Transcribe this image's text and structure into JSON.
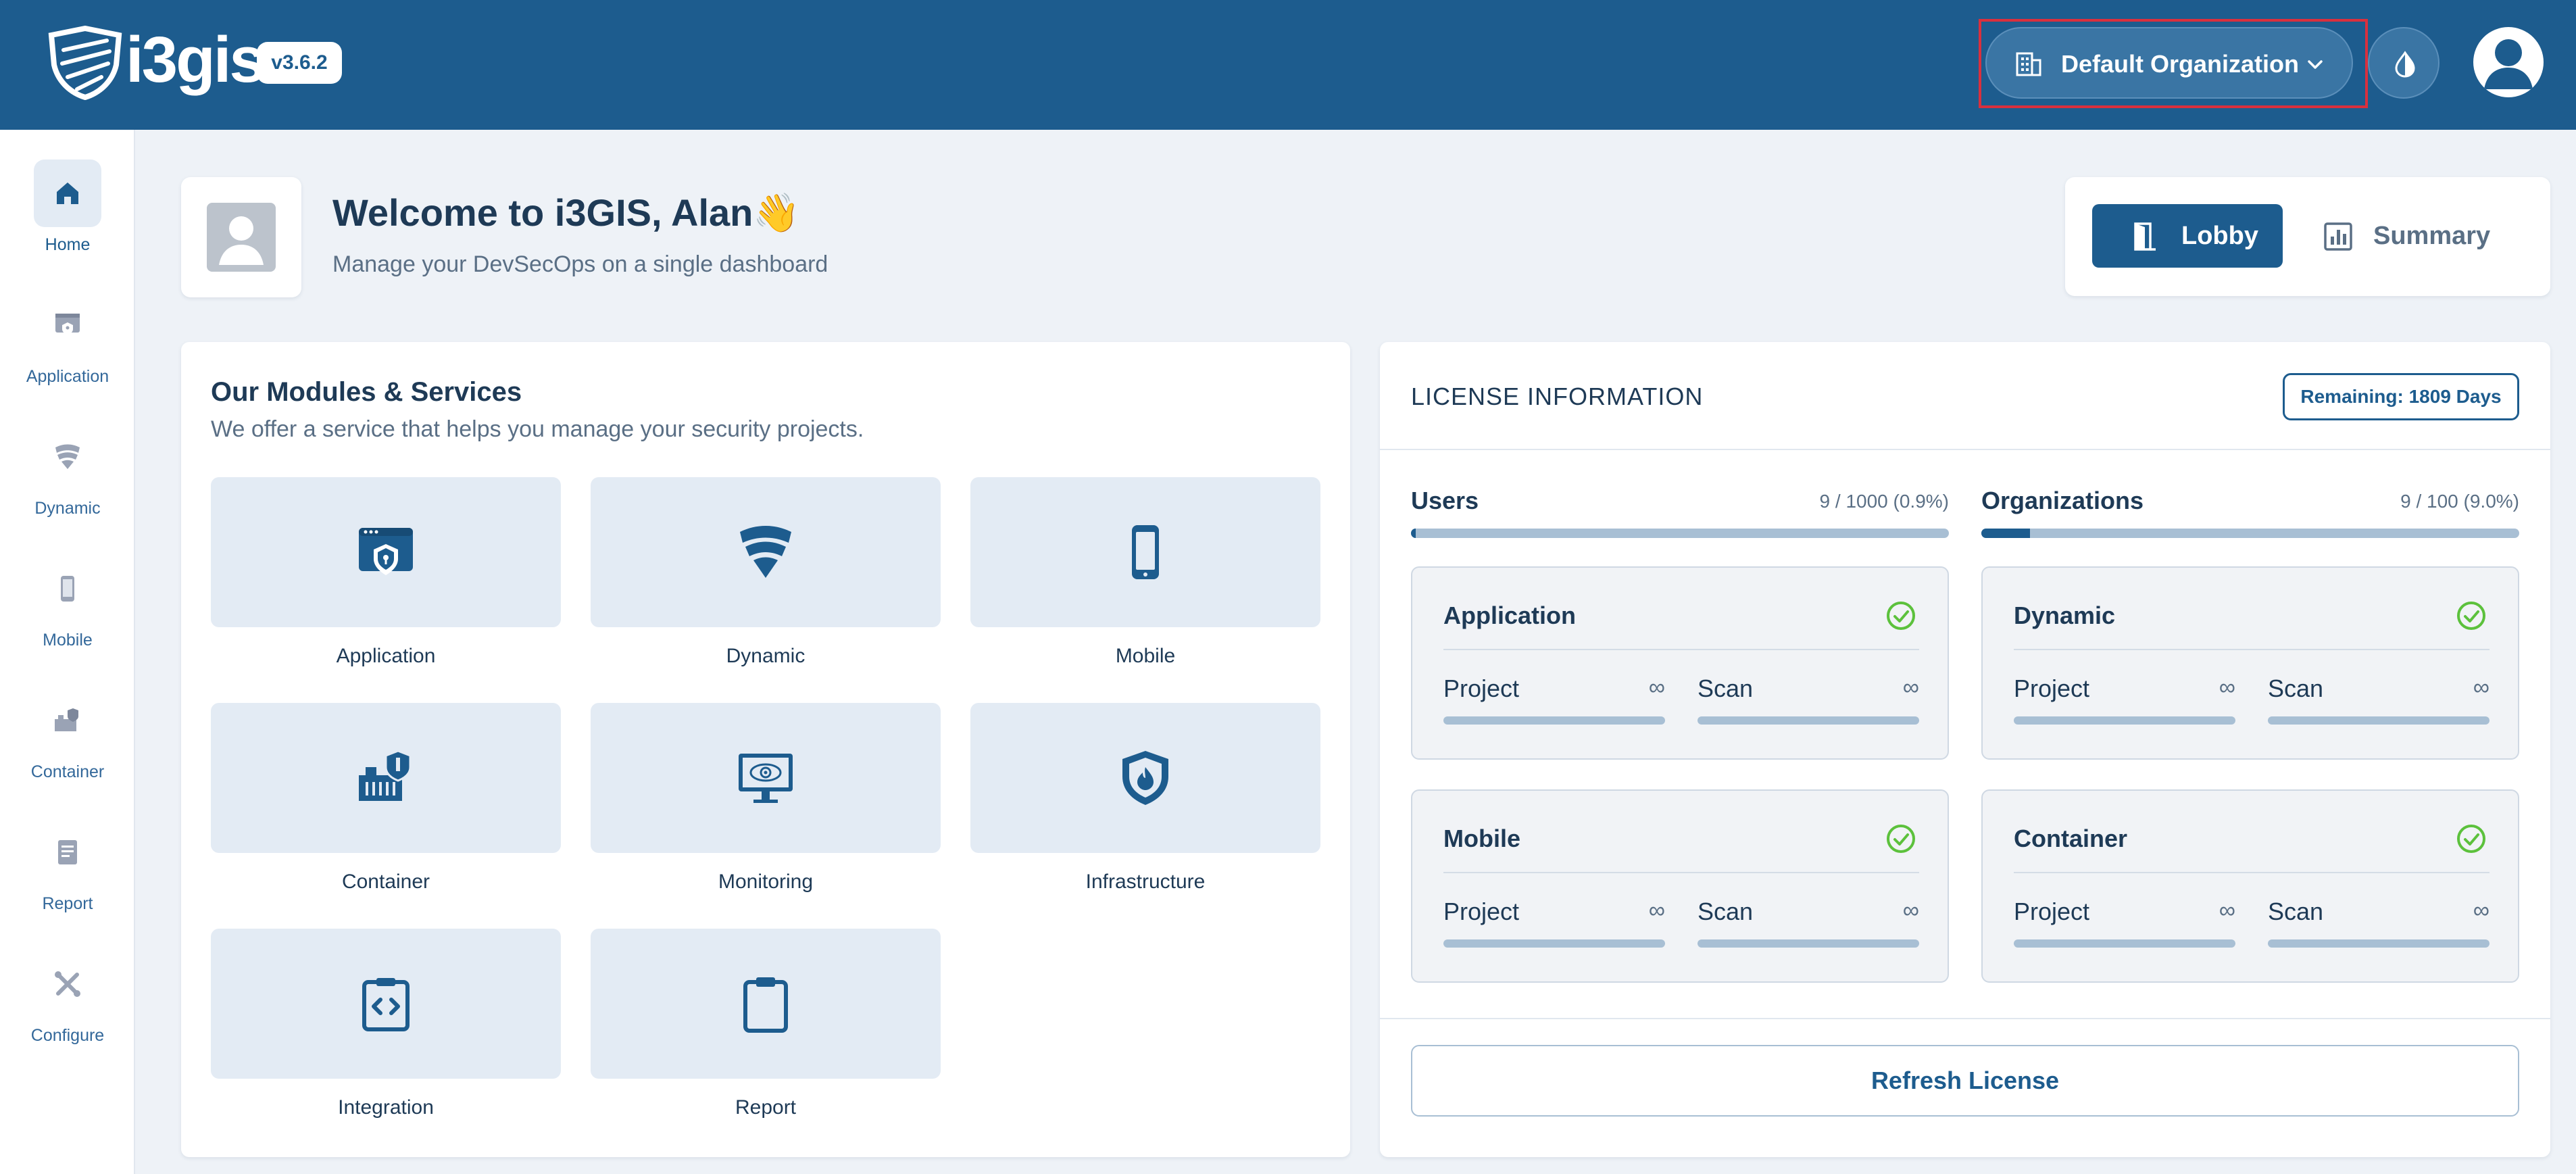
{
  "app": {
    "brand": "i3gis",
    "version": "v3.6.2"
  },
  "header": {
    "organization": "Default Organization",
    "icons": [
      "organization-icon",
      "chevron-down-icon",
      "theme-icon",
      "user-avatar-icon"
    ]
  },
  "sidebar": {
    "items": [
      {
        "label": "Home",
        "icon": "home-icon",
        "active": true
      },
      {
        "label": "Application",
        "icon": "application-icon"
      },
      {
        "label": "Dynamic",
        "icon": "dynamic-icon"
      },
      {
        "label": "Mobile",
        "icon": "mobile-icon"
      },
      {
        "label": "Container",
        "icon": "container-icon"
      },
      {
        "label": "Report",
        "icon": "report-icon"
      },
      {
        "label": "Configure",
        "icon": "configure-icon"
      }
    ]
  },
  "welcome": {
    "title": "Welcome to i3GIS, Alan",
    "emoji": "👋",
    "subtitle": "Manage your DevSecOps on a single dashboard"
  },
  "view_switch": {
    "lobby": "Lobby",
    "summary": "Summary",
    "active": "lobby"
  },
  "modules": {
    "title": "Our Modules & Services",
    "subtitle": "We offer a service that helps you manage your security projects.",
    "items": [
      {
        "label": "Application",
        "icon": "application-icon"
      },
      {
        "label": "Dynamic",
        "icon": "dynamic-icon"
      },
      {
        "label": "Mobile",
        "icon": "mobile-icon"
      },
      {
        "label": "Container",
        "icon": "container-icon"
      },
      {
        "label": "Monitoring",
        "icon": "monitoring-icon"
      },
      {
        "label": "Infrastructure",
        "icon": "infrastructure-icon"
      },
      {
        "label": "Integration",
        "icon": "integration-icon"
      },
      {
        "label": "Report",
        "icon": "report-icon"
      }
    ]
  },
  "license": {
    "title": "LICENSE INFORMATION",
    "remaining": "Remaining: 1809 Days",
    "users": {
      "label": "Users",
      "value": "9 / 1000  (0.9%)",
      "fraction": 0.009
    },
    "organizations": {
      "label": "Organizations",
      "value": "9 / 100  (9.0%)",
      "fraction": 0.09
    },
    "cards": [
      {
        "title": "Application",
        "project_label": "Project",
        "project_value": "∞",
        "scan_label": "Scan",
        "scan_value": "∞"
      },
      {
        "title": "Dynamic",
        "project_label": "Project",
        "project_value": "∞",
        "scan_label": "Scan",
        "scan_value": "∞"
      },
      {
        "title": "Mobile",
        "project_label": "Project",
        "project_value": "∞",
        "scan_label": "Scan",
        "scan_value": "∞"
      },
      {
        "title": "Container",
        "project_label": "Project",
        "project_value": "∞",
        "scan_label": "Scan",
        "scan_value": "∞"
      }
    ],
    "refresh": "Refresh License"
  },
  "colors": {
    "primary": "#1d5c8e",
    "background": "#eef2f7",
    "tile": "#e3ebf4",
    "success": "#5cc13c",
    "highlight": "#d9303e"
  }
}
